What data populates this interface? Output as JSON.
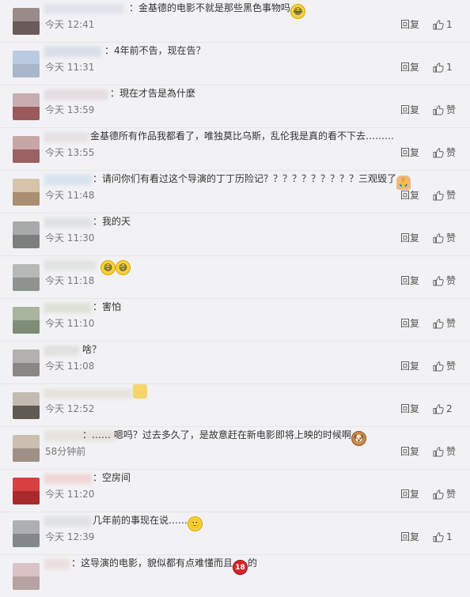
{
  "comments": [
    {
      "text": "：金基德的电影不就是那些黑色事物吗",
      "text_left": 163,
      "emoji": "laugh-cry",
      "time": "今天 12:41",
      "reply": "回复",
      "likes": "1",
      "av_top": "#9a8a88",
      "av_bot": "#6b5a5a",
      "blur": "#e0e3ea",
      "blur_w": 100
    },
    {
      "text": "：4年前不告，现在告？",
      "text_left": 132,
      "emoji": "",
      "time": "今天 11:31",
      "reply": "回复",
      "likes": "1",
      "av_top": "#b9cbe0",
      "av_bot": "#a7b7c9",
      "blur": "#d9dfe9",
      "blur_w": 72
    },
    {
      "text": "：現在才告是為什麼",
      "text_left": 139,
      "emoji": "",
      "time": "今天 13:59",
      "reply": "回复",
      "likes": "赞",
      "av_top": "#c8aeb0",
      "av_bot": "#9a5a5a",
      "blur": "#e3dde0",
      "blur_w": 80
    },
    {
      "text": "金基德所有作品我都看了，唯独莫比乌斯，乱伦我是真的看不下去………",
      "text_left": 114,
      "emoji": "",
      "time": "今天 13:55",
      "reply": "回复",
      "likes": "赞",
      "av_top": "#c9a6a6",
      "av_bot": "#9a6262",
      "blur": "#e6e1e3",
      "blur_w": 56
    },
    {
      "text": "：请问你们有看过这个导演的丁丁历险记？？？？？？？？？？三观毁了",
      "text_left": 117,
      "emoji": "hands",
      "time": "今天 11:48",
      "reply": "回复",
      "likes": "赞",
      "av_top": "#d7c3a8",
      "av_bot": "#a98e6f",
      "blur": "#d6e3ee",
      "blur_w": 60
    },
    {
      "text": "：我的天",
      "text_left": 117,
      "emoji": "",
      "time": "今天 11:30",
      "reply": "回复",
      "likes": "赞",
      "av_top": "#a7aaa8",
      "av_bot": "#7c7f7e",
      "blur": "#dfe2e4",
      "blur_w": 60
    },
    {
      "text": "",
      "text_left": 127,
      "emoji": "sweat-smile",
      "time": "今天 11:18",
      "reply": "回复",
      "likes": "赞",
      "av_top": "#b7b9b8",
      "av_bot": "#8f9390",
      "blur": "#e2e4e3",
      "blur_w": 66
    },
    {
      "text": "：害怕",
      "text_left": 117,
      "emoji": "",
      "time": "今天 11:10",
      "reply": "回复",
      "likes": "赞",
      "av_top": "#a8b59e",
      "av_bot": "#7e8e76",
      "blur": "#dde3d8",
      "blur_w": 60
    },
    {
      "text": "啥？",
      "text_left": 104,
      "emoji": "",
      "time": "今天 11:08",
      "reply": "回复",
      "likes": "赞",
      "av_top": "#b3b0ae",
      "av_bot": "#8b8784",
      "blur": "#e2e0df",
      "blur_w": 44
    },
    {
      "text": "",
      "text_left": 168,
      "emoji": "square",
      "time": "今天 12:52",
      "reply": "回复",
      "likes": "2",
      "av_top": "#c4bcb0",
      "av_bot": "#5f5a52",
      "blur": "#e6e3de",
      "blur_w": 112
    },
    {
      "text": "：…… 嗯吗？过去多久了，是故意赶在新电影即将上映的时候啊",
      "text_left": 104,
      "emoji": "doge",
      "time": "58分钟前",
      "reply": "回复",
      "likes": "赞",
      "av_top": "#cbbfb0",
      "av_bot": "#9e9084",
      "blur": "#e7e2dc",
      "blur_w": 90
    },
    {
      "text": "：空房间",
      "text_left": 117,
      "emoji": "",
      "time": "今天 11:20",
      "reply": "回复",
      "likes": "赞",
      "av_top": "#d64040",
      "av_bot": "#a92a2a",
      "blur": "#f0d6d6",
      "blur_w": 60
    },
    {
      "text": "几年前的事现在说……",
      "text_left": 117,
      "emoji": "smile",
      "time": "今天 12:39",
      "reply": "回复",
      "likes": "1",
      "av_top": "#adb0b3",
      "av_bot": "#83878b",
      "blur": "#e0e2e4",
      "blur_w": 60
    },
    {
      "text": "：这导演的电影，貌似都有点难懂而且",
      "text_left": 90,
      "emoji": "18",
      "emoji_suffix": "的",
      "time": "",
      "reply": "",
      "likes": "",
      "av_top": "#d8c4c4",
      "av_bot": "#b9a2a2",
      "blur": "#ecdede",
      "blur_w": 32
    }
  ]
}
